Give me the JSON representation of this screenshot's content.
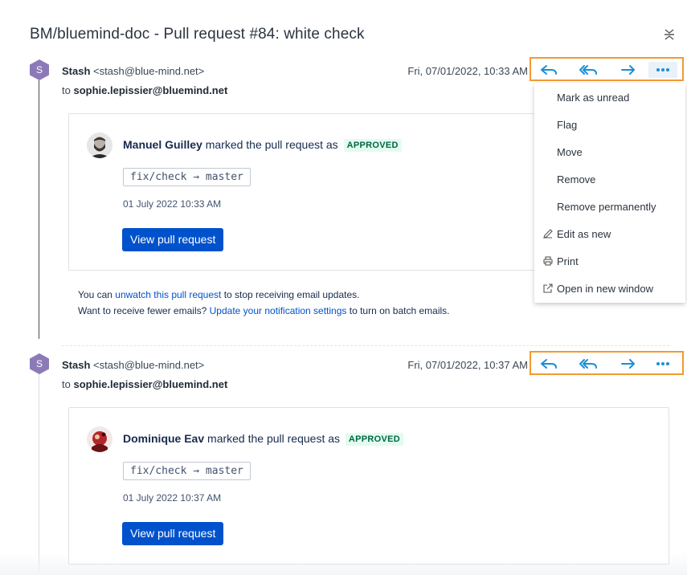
{
  "window": {
    "title": "BM/bluemind-doc - Pull request #84: white check",
    "collapse_icon": "collapse-icon"
  },
  "colors": {
    "thread_avatar": "#8c7ab8",
    "highlight_border": "#f29a31",
    "action_icons": "#1a8fd6",
    "button_bg": "#0052cc",
    "approved_bg": "#e3fcef",
    "approved_text": "#006644"
  },
  "messages": [
    {
      "avatar_letter": "S",
      "sender_name": "Stash",
      "sender_address": "<stash@blue-mind.net>",
      "to_prefix": "to",
      "recipient": "sophie.lepissier@bluemind.net",
      "date": "Fri, 07/01/2022, 10:33 AM",
      "card": {
        "person": "Manuel Guilley",
        "action_text": "marked the pull request as",
        "status": "APPROVED",
        "branch": "fix/check → master",
        "timestamp": "01 July 2022 10:33 AM",
        "button_label": "View pull request"
      },
      "footer": {
        "line1_prefix": "You can",
        "line1_link": "unwatch this pull request",
        "line1_suffix": "to stop receiving email updates.",
        "line2_prefix": "Want to receive fewer emails?",
        "line2_link": "Update your notification settings",
        "line2_suffix": "to turn on batch emails."
      }
    },
    {
      "avatar_letter": "S",
      "sender_name": "Stash",
      "sender_address": "<stash@blue-mind.net>",
      "to_prefix": "to",
      "recipient": "sophie.lepissier@bluemind.net",
      "date": "Fri, 07/01/2022, 10:37 AM",
      "card": {
        "person": "Dominique Eav",
        "action_text": "marked the pull request as",
        "status": "APPROVED",
        "branch": "fix/check → master",
        "timestamp": "01 July 2022 10:37 AM",
        "button_label": "View pull request"
      }
    }
  ],
  "actions": [
    "reply-icon",
    "reply-all-icon",
    "forward-icon",
    "more-options-icon"
  ],
  "dropdown": {
    "items": [
      {
        "label": "Mark as unread",
        "icon": ""
      },
      {
        "label": "Flag",
        "icon": ""
      },
      {
        "label": "Move",
        "icon": ""
      },
      {
        "label": "Remove",
        "icon": ""
      },
      {
        "label": "Remove permanently",
        "icon": ""
      },
      {
        "label": "Edit as new",
        "icon": "pencil-icon"
      },
      {
        "label": "Print",
        "icon": "printer-icon"
      },
      {
        "label": "Open in new window",
        "icon": "external-window-icon"
      }
    ]
  }
}
